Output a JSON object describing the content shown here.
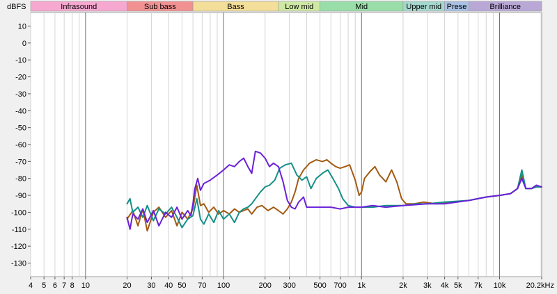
{
  "chart_data": {
    "type": "line",
    "ylabel": "dBFS",
    "x_scale": "log",
    "xlim": [
      4,
      20200
    ],
    "ylim": [
      -138,
      18
    ],
    "grid": true,
    "legend": "none",
    "bands": [
      {
        "name": "Infrasound",
        "from": 4,
        "to": 20,
        "color": "#f7a8d0"
      },
      {
        "name": "Sub bass",
        "from": 20,
        "to": 60,
        "color": "#f19191"
      },
      {
        "name": "Bass",
        "from": 60,
        "to": 250,
        "color": "#f3de9a"
      },
      {
        "name": "Low mid",
        "from": 250,
        "to": 500,
        "color": "#cfe9a3"
      },
      {
        "name": "Mid",
        "from": 500,
        "to": 2000,
        "color": "#99dea9"
      },
      {
        "name": "Upper mid",
        "from": 2000,
        "to": 4000,
        "color": "#a5d8ce"
      },
      {
        "name": "Prese",
        "from": 4000,
        "to": 6000,
        "color": "#a9c1e4"
      },
      {
        "name": "Brilliance",
        "from": 6000,
        "to": 20200,
        "color": "#b9a8d6"
      }
    ],
    "y_ticks": [
      10,
      0,
      -10,
      -20,
      -30,
      -40,
      -50,
      -60,
      -70,
      -80,
      -90,
      -100,
      -110,
      -120,
      -130
    ],
    "x_tick_labels": [
      {
        "v": 4,
        "t": "4"
      },
      {
        "v": 5,
        "t": "5"
      },
      {
        "v": 6,
        "t": "6"
      },
      {
        "v": 7,
        "t": "7"
      },
      {
        "v": 8,
        "t": "8"
      },
      {
        "v": 10,
        "t": "10"
      },
      {
        "v": 20,
        "t": "20"
      },
      {
        "v": 30,
        "t": "30"
      },
      {
        "v": 40,
        "t": "40"
      },
      {
        "v": 50,
        "t": "50"
      },
      {
        "v": 70,
        "t": "70"
      },
      {
        "v": 100,
        "t": "100"
      },
      {
        "v": 200,
        "t": "200"
      },
      {
        "v": 300,
        "t": "300"
      },
      {
        "v": 500,
        "t": "500"
      },
      {
        "v": 700,
        "t": "700"
      },
      {
        "v": 1000,
        "t": "1k"
      },
      {
        "v": 2000,
        "t": "2k"
      },
      {
        "v": 3000,
        "t": "3k"
      },
      {
        "v": 4000,
        "t": "4k"
      },
      {
        "v": 5000,
        "t": "5k"
      },
      {
        "v": 7000,
        "t": "7k"
      },
      {
        "v": 10000,
        "t": "10k"
      },
      {
        "v": 20200,
        "t": "20.2kHz"
      }
    ],
    "series": [
      {
        "color": "#a35a12",
        "points": [
          [
            20,
            -104
          ],
          [
            22,
            -99
          ],
          [
            24,
            -108
          ],
          [
            26,
            -98
          ],
          [
            28,
            -111
          ],
          [
            31,
            -100
          ],
          [
            34,
            -97
          ],
          [
            38,
            -103
          ],
          [
            42,
            -99
          ],
          [
            46,
            -108
          ],
          [
            50,
            -100
          ],
          [
            55,
            -104
          ],
          [
            60,
            -98
          ],
          [
            64,
            -84
          ],
          [
            68,
            -96
          ],
          [
            72,
            -95
          ],
          [
            78,
            -100
          ],
          [
            85,
            -97
          ],
          [
            92,
            -101
          ],
          [
            100,
            -99
          ],
          [
            110,
            -101
          ],
          [
            120,
            -98
          ],
          [
            130,
            -100
          ],
          [
            140,
            -99
          ],
          [
            150,
            -98
          ],
          [
            160,
            -101
          ],
          [
            175,
            -97
          ],
          [
            190,
            -96
          ],
          [
            210,
            -99
          ],
          [
            230,
            -97
          ],
          [
            250,
            -99
          ],
          [
            270,
            -101
          ],
          [
            290,
            -98
          ],
          [
            310,
            -94
          ],
          [
            330,
            -88
          ],
          [
            350,
            -80
          ],
          [
            380,
            -75
          ],
          [
            420,
            -71
          ],
          [
            470,
            -69
          ],
          [
            520,
            -70
          ],
          [
            560,
            -69
          ],
          [
            600,
            -71
          ],
          [
            650,
            -73
          ],
          [
            700,
            -74
          ],
          [
            760,
            -73
          ],
          [
            820,
            -72
          ],
          [
            900,
            -81
          ],
          [
            960,
            -90
          ],
          [
            1000,
            -88
          ],
          [
            1050,
            -80
          ],
          [
            1150,
            -76
          ],
          [
            1250,
            -73
          ],
          [
            1350,
            -78
          ],
          [
            1500,
            -82
          ],
          [
            1650,
            -75
          ],
          [
            1800,
            -82
          ],
          [
            1950,
            -92
          ],
          [
            2100,
            -95
          ],
          [
            2400,
            -95
          ],
          [
            2800,
            -94
          ],
          [
            3500,
            -95
          ],
          [
            4500,
            -94
          ],
          [
            6000,
            -93
          ],
          [
            8000,
            -91
          ],
          [
            10000,
            -90
          ],
          [
            12000,
            -89
          ],
          [
            13500,
            -86
          ],
          [
            14500,
            -78
          ],
          [
            15500,
            -86
          ],
          [
            17000,
            -86
          ],
          [
            18500,
            -85
          ],
          [
            20200,
            -85
          ]
        ]
      },
      {
        "color": "#149088",
        "points": [
          [
            20,
            -95
          ],
          [
            21,
            -92
          ],
          [
            22,
            -100
          ],
          [
            24,
            -97
          ],
          [
            26,
            -103
          ],
          [
            28,
            -96
          ],
          [
            31,
            -105
          ],
          [
            34,
            -98
          ],
          [
            38,
            -101
          ],
          [
            42,
            -97
          ],
          [
            46,
            -103
          ],
          [
            50,
            -109
          ],
          [
            55,
            -104
          ],
          [
            60,
            -102
          ],
          [
            64,
            -92
          ],
          [
            68,
            -104
          ],
          [
            72,
            -107
          ],
          [
            78,
            -101
          ],
          [
            85,
            -106
          ],
          [
            92,
            -99
          ],
          [
            100,
            -104
          ],
          [
            110,
            -101
          ],
          [
            120,
            -106
          ],
          [
            130,
            -100
          ],
          [
            140,
            -98
          ],
          [
            150,
            -97
          ],
          [
            160,
            -95
          ],
          [
            170,
            -92
          ],
          [
            185,
            -88
          ],
          [
            200,
            -85
          ],
          [
            215,
            -84
          ],
          [
            235,
            -81
          ],
          [
            255,
            -74
          ],
          [
            280,
            -72
          ],
          [
            310,
            -71
          ],
          [
            340,
            -78
          ],
          [
            370,
            -81
          ],
          [
            400,
            -79
          ],
          [
            430,
            -86
          ],
          [
            470,
            -80
          ],
          [
            520,
            -77
          ],
          [
            570,
            -75
          ],
          [
            620,
            -80
          ],
          [
            680,
            -86
          ],
          [
            730,
            -92
          ],
          [
            800,
            -96
          ],
          [
            900,
            -97
          ],
          [
            1000,
            -97
          ],
          [
            1200,
            -97
          ],
          [
            1500,
            -96
          ],
          [
            2000,
            -96
          ],
          [
            2500,
            -95
          ],
          [
            3000,
            -95
          ],
          [
            4000,
            -94
          ],
          [
            6000,
            -93
          ],
          [
            8000,
            -91
          ],
          [
            10000,
            -90
          ],
          [
            12000,
            -89
          ],
          [
            13500,
            -86
          ],
          [
            14500,
            -75
          ],
          [
            15500,
            -86
          ],
          [
            17000,
            -86
          ],
          [
            18500,
            -85
          ],
          [
            20200,
            -85
          ]
        ]
      },
      {
        "color": "#6a22d8",
        "points": [
          [
            20,
            -103
          ],
          [
            21,
            -110
          ],
          [
            22,
            -101
          ],
          [
            24,
            -104
          ],
          [
            26,
            -98
          ],
          [
            28,
            -106
          ],
          [
            31,
            -99
          ],
          [
            34,
            -108
          ],
          [
            38,
            -100
          ],
          [
            42,
            -103
          ],
          [
            46,
            -97
          ],
          [
            50,
            -104
          ],
          [
            55,
            -99
          ],
          [
            58,
            -102
          ],
          [
            60,
            -95
          ],
          [
            62,
            -86
          ],
          [
            65,
            -80
          ],
          [
            68,
            -87
          ],
          [
            72,
            -83
          ],
          [
            80,
            -81
          ],
          [
            90,
            -78
          ],
          [
            100,
            -75
          ],
          [
            110,
            -72
          ],
          [
            120,
            -73
          ],
          [
            130,
            -70
          ],
          [
            140,
            -68
          ],
          [
            150,
            -73
          ],
          [
            160,
            -77
          ],
          [
            170,
            -64
          ],
          [
            185,
            -65
          ],
          [
            200,
            -68
          ],
          [
            215,
            -73
          ],
          [
            230,
            -71
          ],
          [
            250,
            -73
          ],
          [
            270,
            -82
          ],
          [
            290,
            -93
          ],
          [
            310,
            -97
          ],
          [
            330,
            -98
          ],
          [
            350,
            -94
          ],
          [
            380,
            -91
          ],
          [
            400,
            -97
          ],
          [
            440,
            -97
          ],
          [
            500,
            -97
          ],
          [
            600,
            -97
          ],
          [
            700,
            -98
          ],
          [
            800,
            -97
          ],
          [
            1000,
            -97
          ],
          [
            1200,
            -96
          ],
          [
            1500,
            -97
          ],
          [
            2000,
            -96
          ],
          [
            3000,
            -95
          ],
          [
            4000,
            -95
          ],
          [
            6000,
            -93
          ],
          [
            8000,
            -91
          ],
          [
            10000,
            -90
          ],
          [
            12000,
            -89
          ],
          [
            13500,
            -86
          ],
          [
            14500,
            -80
          ],
          [
            15500,
            -86
          ],
          [
            17000,
            -86
          ],
          [
            18500,
            -84
          ],
          [
            20200,
            -85
          ]
        ]
      }
    ]
  }
}
